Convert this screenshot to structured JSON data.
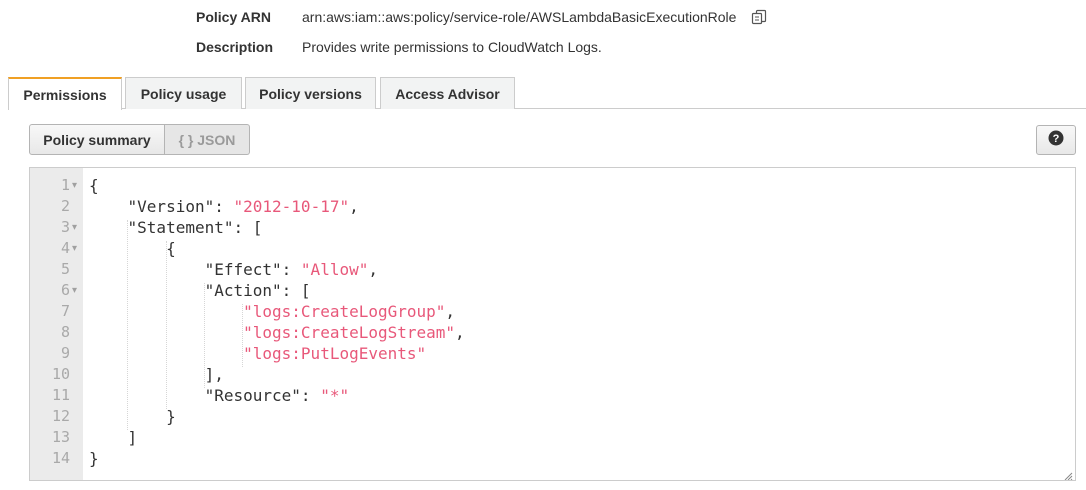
{
  "policy": {
    "arn_label": "Policy ARN",
    "arn_value": "arn:aws:iam::aws:policy/service-role/AWSLambdaBasicExecutionRole",
    "description_label": "Description",
    "description_value": "Provides write permissions to CloudWatch Logs."
  },
  "tabs": [
    {
      "label": "Permissions",
      "active": true
    },
    {
      "label": "Policy usage",
      "active": false
    },
    {
      "label": "Policy versions",
      "active": false
    },
    {
      "label": "Access Advisor",
      "active": false
    }
  ],
  "view_toggle": {
    "summary_label": "Policy summary",
    "json_label": "{ } JSON"
  },
  "help_button": {
    "icon": "question-icon"
  },
  "editor": {
    "lines": [
      {
        "num": "1",
        "fold": true,
        "tokens": [
          [
            "p",
            "{"
          ]
        ]
      },
      {
        "num": "2",
        "fold": false,
        "tokens": [
          [
            "p",
            "    \"Version\": "
          ],
          [
            "s",
            "\"2012-10-17\""
          ],
          [
            "p",
            ","
          ]
        ]
      },
      {
        "num": "3",
        "fold": true,
        "tokens": [
          [
            "p",
            "    \"Statement\": ["
          ]
        ]
      },
      {
        "num": "4",
        "fold": true,
        "tokens": [
          [
            "p",
            "        {"
          ]
        ]
      },
      {
        "num": "5",
        "fold": false,
        "tokens": [
          [
            "p",
            "            \"Effect\": "
          ],
          [
            "s",
            "\"Allow\""
          ],
          [
            "p",
            ","
          ]
        ]
      },
      {
        "num": "6",
        "fold": true,
        "tokens": [
          [
            "p",
            "            \"Action\": ["
          ]
        ]
      },
      {
        "num": "7",
        "fold": false,
        "tokens": [
          [
            "p",
            "                "
          ],
          [
            "s",
            "\"logs:CreateLogGroup\""
          ],
          [
            "p",
            ","
          ]
        ]
      },
      {
        "num": "8",
        "fold": false,
        "tokens": [
          [
            "p",
            "                "
          ],
          [
            "s",
            "\"logs:CreateLogStream\""
          ],
          [
            "p",
            ","
          ]
        ]
      },
      {
        "num": "9",
        "fold": false,
        "tokens": [
          [
            "p",
            "                "
          ],
          [
            "s",
            "\"logs:PutLogEvents\""
          ]
        ]
      },
      {
        "num": "10",
        "fold": false,
        "tokens": [
          [
            "p",
            "            ],"
          ]
        ]
      },
      {
        "num": "11",
        "fold": false,
        "tokens": [
          [
            "p",
            "            \"Resource\": "
          ],
          [
            "s",
            "\"*\""
          ]
        ]
      },
      {
        "num": "12",
        "fold": false,
        "tokens": [
          [
            "p",
            "        }"
          ]
        ]
      },
      {
        "num": "13",
        "fold": false,
        "tokens": [
          [
            "p",
            "    ]"
          ]
        ]
      },
      {
        "num": "14",
        "fold": false,
        "tokens": [
          [
            "p",
            "}"
          ]
        ]
      }
    ]
  },
  "colors": {
    "string": "#e8587a",
    "active_tab_accent": "#f0a024",
    "gutter_bg": "#ebebeb"
  }
}
